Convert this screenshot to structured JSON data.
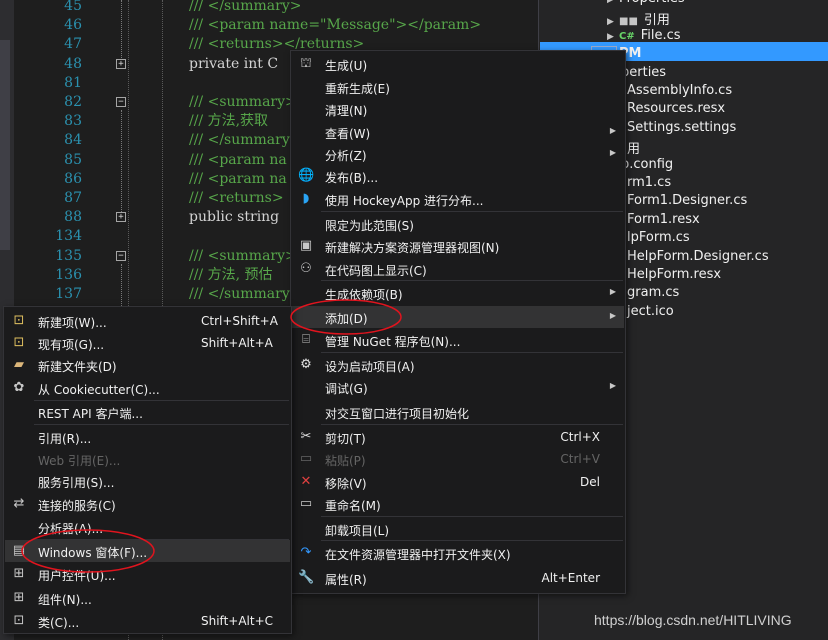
{
  "editor": {
    "lines": [
      {
        "num": "45",
        "text": "/// </summary>",
        "type": "cm"
      },
      {
        "num": "46",
        "text": "/// <param name=\"Message\"></param>",
        "type": "cm"
      },
      {
        "num": "47",
        "text": "/// <returns></returns>",
        "type": "cm"
      },
      {
        "num": "48",
        "text": "private int C",
        "type": "code"
      },
      {
        "num": "81",
        "text": "",
        "type": "blank"
      },
      {
        "num": "82",
        "text": "/// <summary>",
        "type": "cm"
      },
      {
        "num": "83",
        "text": "/// 方法,获取",
        "type": "cm"
      },
      {
        "num": "84",
        "text": "/// </summary",
        "type": "cm"
      },
      {
        "num": "85",
        "text": "/// <param na",
        "type": "cm"
      },
      {
        "num": "86",
        "text": "/// <param na",
        "type": "cm"
      },
      {
        "num": "87",
        "text": "/// <returns>",
        "type": "cm"
      },
      {
        "num": "88",
        "text": "public string",
        "type": "code"
      },
      {
        "num": "134",
        "text": "",
        "type": "blank"
      },
      {
        "num": "135",
        "text": "/// <summary>",
        "type": "cm"
      },
      {
        "num": "136",
        "text": "/// 方法, 预估",
        "type": "cm"
      },
      {
        "num": "137",
        "text": "/// </summary",
        "type": "cm"
      }
    ]
  },
  "solution_explorer": {
    "items": [
      {
        "label": "Properties",
        "icon": "folder-icon"
      },
      {
        "label": "引用",
        "icon": "references-icon"
      },
      {
        "label": "File.cs",
        "icon": "csharp-file-icon"
      },
      {
        "label": "PM",
        "icon": "project-icon",
        "selected": true
      },
      {
        "label": "perties",
        "icon": ""
      },
      {
        "label": "AssemblyInfo.cs",
        "icon": ""
      },
      {
        "label": "Resources.resx",
        "icon": ""
      },
      {
        "label": "Settings.settings",
        "icon": ""
      },
      {
        "label": "用",
        "icon": ""
      },
      {
        "label": "p.config",
        "icon": ""
      },
      {
        "label": "rm1.cs",
        "icon": ""
      },
      {
        "label": "Form1.Designer.cs",
        "icon": ""
      },
      {
        "label": "Form1.resx",
        "icon": ""
      },
      {
        "label": "lpForm.cs",
        "icon": ""
      },
      {
        "label": "HelpForm.Designer.cs",
        "icon": ""
      },
      {
        "label": "HelpForm.resx",
        "icon": ""
      },
      {
        "label": "gram.cs",
        "icon": ""
      },
      {
        "label": "ject.ico",
        "icon": ""
      }
    ]
  },
  "context_menu": {
    "items": [
      {
        "label": "生成(U)",
        "icon": "build-icon",
        "shortcut": "",
        "submenu": false
      },
      {
        "label": "重新生成(E)",
        "icon": "",
        "shortcut": "",
        "submenu": false
      },
      {
        "label": "清理(N)",
        "icon": "",
        "shortcut": "",
        "submenu": false
      },
      {
        "label": "查看(W)",
        "icon": "",
        "shortcut": "",
        "submenu": true
      },
      {
        "label": "分析(Z)",
        "icon": "",
        "shortcut": "",
        "submenu": true
      },
      {
        "label": "发布(B)...",
        "icon": "globe-icon",
        "shortcut": "",
        "submenu": false
      },
      {
        "label": "使用 HockeyApp 进行分布...",
        "icon": "hockeyapp-icon",
        "shortcut": "",
        "submenu": false
      },
      {
        "label": "限定为此范围(S)",
        "icon": "",
        "shortcut": "",
        "submenu": false
      },
      {
        "label": "新建解决方案资源管理器视图(N)",
        "icon": "new-view-icon",
        "shortcut": "",
        "submenu": false
      },
      {
        "label": "在代码图上显示(C)",
        "icon": "code-map-icon",
        "shortcut": "",
        "submenu": false
      },
      {
        "label": "生成依赖项(B)",
        "icon": "",
        "shortcut": "",
        "submenu": true
      },
      {
        "label": "添加(D)",
        "icon": "",
        "shortcut": "",
        "submenu": true
      },
      {
        "label": "管理 NuGet 程序包(N)...",
        "icon": "nuget-icon",
        "shortcut": "",
        "submenu": false
      },
      {
        "label": "设为启动项目(A)",
        "icon": "gear-icon",
        "shortcut": "",
        "submenu": false
      },
      {
        "label": "调试(G)",
        "icon": "",
        "shortcut": "",
        "submenu": true
      },
      {
        "label": "对交互窗口进行项目初始化",
        "icon": "",
        "shortcut": "",
        "submenu": false
      },
      {
        "label": "剪切(T)",
        "icon": "scissors-icon",
        "shortcut": "Ctrl+X",
        "submenu": false
      },
      {
        "label": "粘贴(P)",
        "icon": "paste-icon",
        "shortcut": "Ctrl+V",
        "submenu": false,
        "disabled": true
      },
      {
        "label": "移除(V)",
        "icon": "remove-icon",
        "shortcut": "Del",
        "submenu": false
      },
      {
        "label": "重命名(M)",
        "icon": "rename-icon",
        "shortcut": "",
        "submenu": false
      },
      {
        "label": "卸载项目(L)",
        "icon": "",
        "shortcut": "",
        "submenu": false
      },
      {
        "label": "在文件资源管理器中打开文件夹(X)",
        "icon": "refresh-arrow-icon",
        "shortcut": "",
        "submenu": false
      },
      {
        "label": "属性(R)",
        "icon": "wrench-icon",
        "shortcut": "Alt+Enter",
        "submenu": false
      }
    ]
  },
  "add_submenu": {
    "items": [
      {
        "label": "新建项(W)...",
        "icon": "new-item-icon",
        "shortcut": "Ctrl+Shift+A"
      },
      {
        "label": "现有项(G)...",
        "icon": "existing-item-icon",
        "shortcut": "Shift+Alt+A"
      },
      {
        "label": "新建文件夹(D)",
        "icon": "new-folder-icon",
        "shortcut": ""
      },
      {
        "label": "从 Cookiecutter(C)...",
        "icon": "cookiecutter-icon",
        "shortcut": ""
      },
      {
        "label": "REST API 客户端...",
        "icon": "",
        "shortcut": ""
      },
      {
        "label": "引用(R)...",
        "icon": "",
        "shortcut": ""
      },
      {
        "label": "Web 引用(E)...",
        "icon": "",
        "shortcut": "",
        "disabled": true
      },
      {
        "label": "服务引用(S)...",
        "icon": "",
        "shortcut": ""
      },
      {
        "label": "连接的服务(C)",
        "icon": "connected-service-icon",
        "shortcut": ""
      },
      {
        "label": "分析器(A)...",
        "icon": "",
        "shortcut": ""
      },
      {
        "label": "Windows 窗体(F)...",
        "icon": "windows-form-icon",
        "shortcut": ""
      },
      {
        "label": "用户控件(U)...",
        "icon": "user-control-icon",
        "shortcut": ""
      },
      {
        "label": "组件(N)...",
        "icon": "component-icon",
        "shortcut": ""
      },
      {
        "label": "类(C)...",
        "icon": "class-icon",
        "shortcut": "Shift+Alt+C"
      }
    ]
  },
  "colors": {
    "accent": "#3399ff",
    "annotation": "#e0141e",
    "comment": "#57a64a",
    "keyword": "#569cd6"
  },
  "watermark": "https://blog.csdn.net/HITLIVING"
}
